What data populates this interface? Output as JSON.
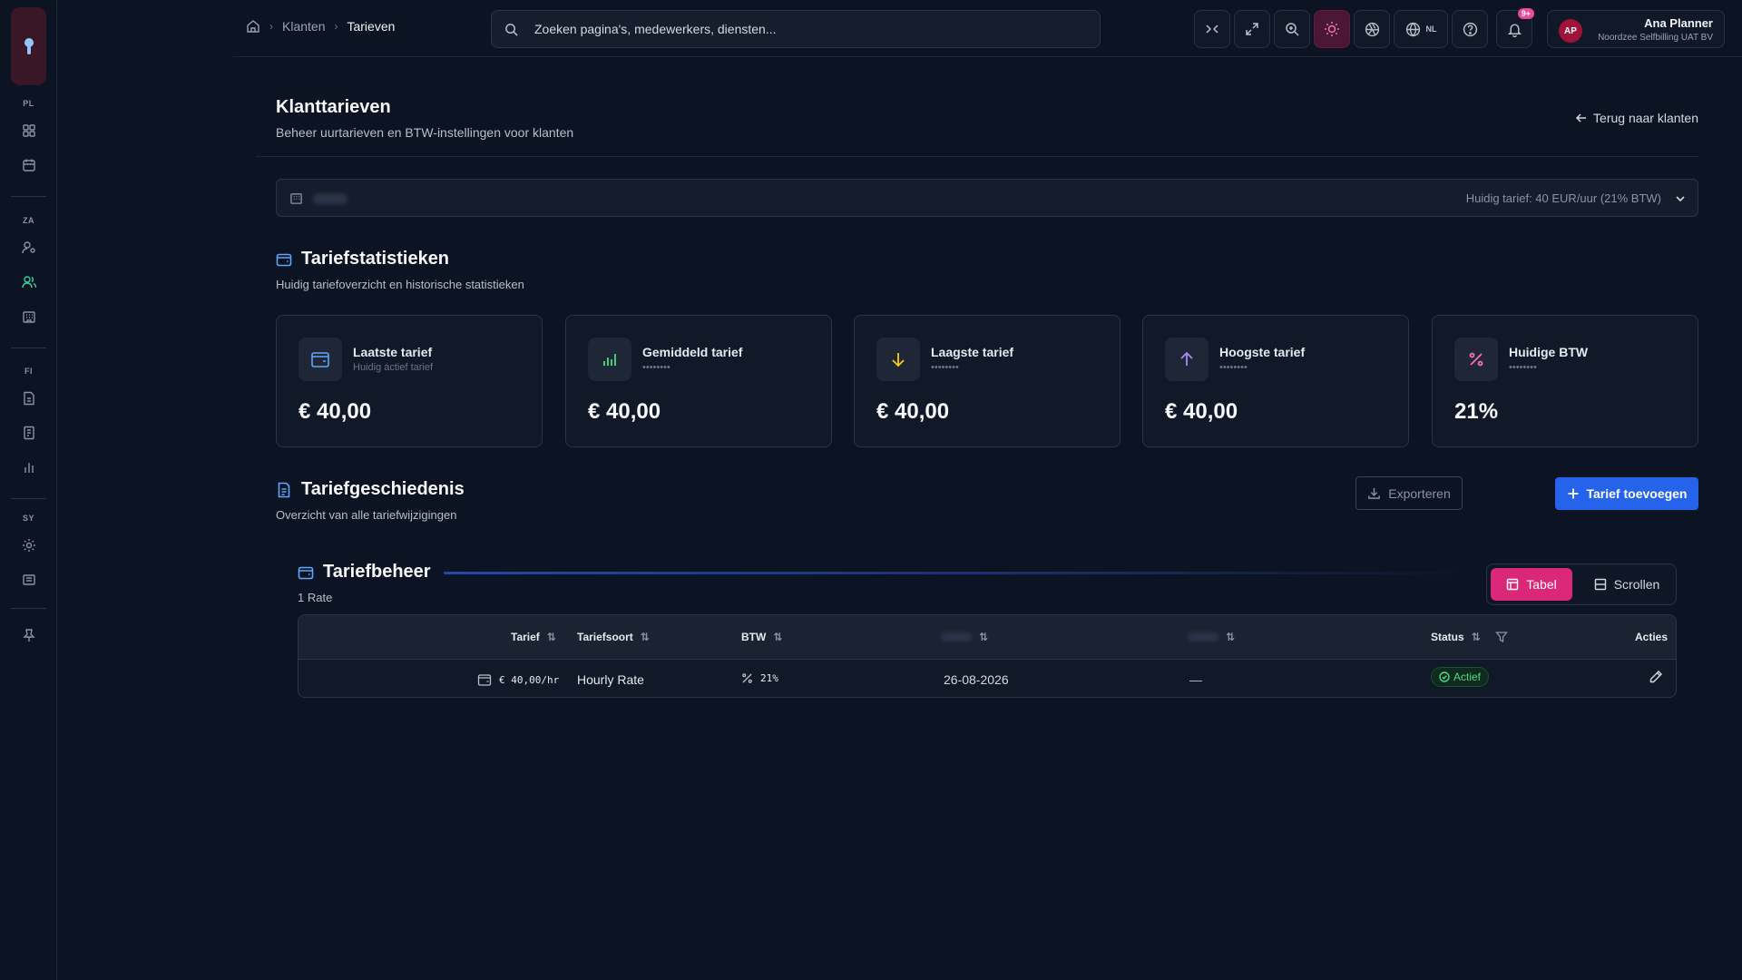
{
  "breadcrumb": {
    "home": "home",
    "items": [
      "Klanten",
      "Tarieven"
    ]
  },
  "search": {
    "placeholder": "Zoeken pagina's, medewerkers, diensten..."
  },
  "topbar": {
    "language": "NL",
    "notifications_badge": "9+"
  },
  "user": {
    "initials": "AP",
    "name": "Ana Planner",
    "org": "Noordzee Selfbilling UAT BV"
  },
  "rail": {
    "sections": [
      "PL",
      "ZA",
      "FI",
      "SY"
    ]
  },
  "page": {
    "title": "Klanttarieven",
    "subtitle": "Beheer uurtarieven en BTW-instellingen voor klanten",
    "back": "Terug naar klanten"
  },
  "client_select": {
    "current_tariff": "Huidig tarief: 40 EUR/uur (21% BTW)"
  },
  "stats_section": {
    "title": "Tariefstatistieken",
    "subtitle": "Huidig tariefoverzicht en historische statistieken",
    "cards": [
      {
        "label": "Laatste tarief",
        "sub": "Huidig actief tarief",
        "value": "€ 40,00",
        "icon": "wallet-icon",
        "color": "#60a5fa"
      },
      {
        "label": "Gemiddeld tarief",
        "sub": "••••••••",
        "value": "€ 40,00",
        "icon": "bar-chart-icon",
        "color": "#4ade80"
      },
      {
        "label": "Laagste tarief",
        "sub": "••••••••",
        "value": "€ 40,00",
        "icon": "arrow-down-icon",
        "color": "#facc15"
      },
      {
        "label": "Hoogste tarief",
        "sub": "••••••••",
        "value": "€ 40,00",
        "icon": "arrow-up-icon",
        "color": "#a78bfa"
      },
      {
        "label": "Huidige BTW",
        "sub": "••••••••",
        "value": "21%",
        "icon": "percent-icon",
        "color": "#f472b6"
      }
    ]
  },
  "history": {
    "title": "Tariefgeschiedenis",
    "subtitle": "Overzicht van alle tariefwijzigingen",
    "export": "Exporteren",
    "add": "Tarief toevoegen"
  },
  "management": {
    "title": "Tariefbeheer",
    "count": "1 Rate",
    "view_table": "Tabel",
    "view_scroll": "Scrollen",
    "columns": [
      "Tarief",
      "Tariefsoort",
      "BTW",
      "Status",
      "Acties"
    ],
    "rows": [
      {
        "tarief": "€ 40,00/hr",
        "soort": "Hourly Rate",
        "btw": "21%",
        "date": "26-08-2026",
        "end": "—",
        "status": "Actief"
      }
    ]
  }
}
